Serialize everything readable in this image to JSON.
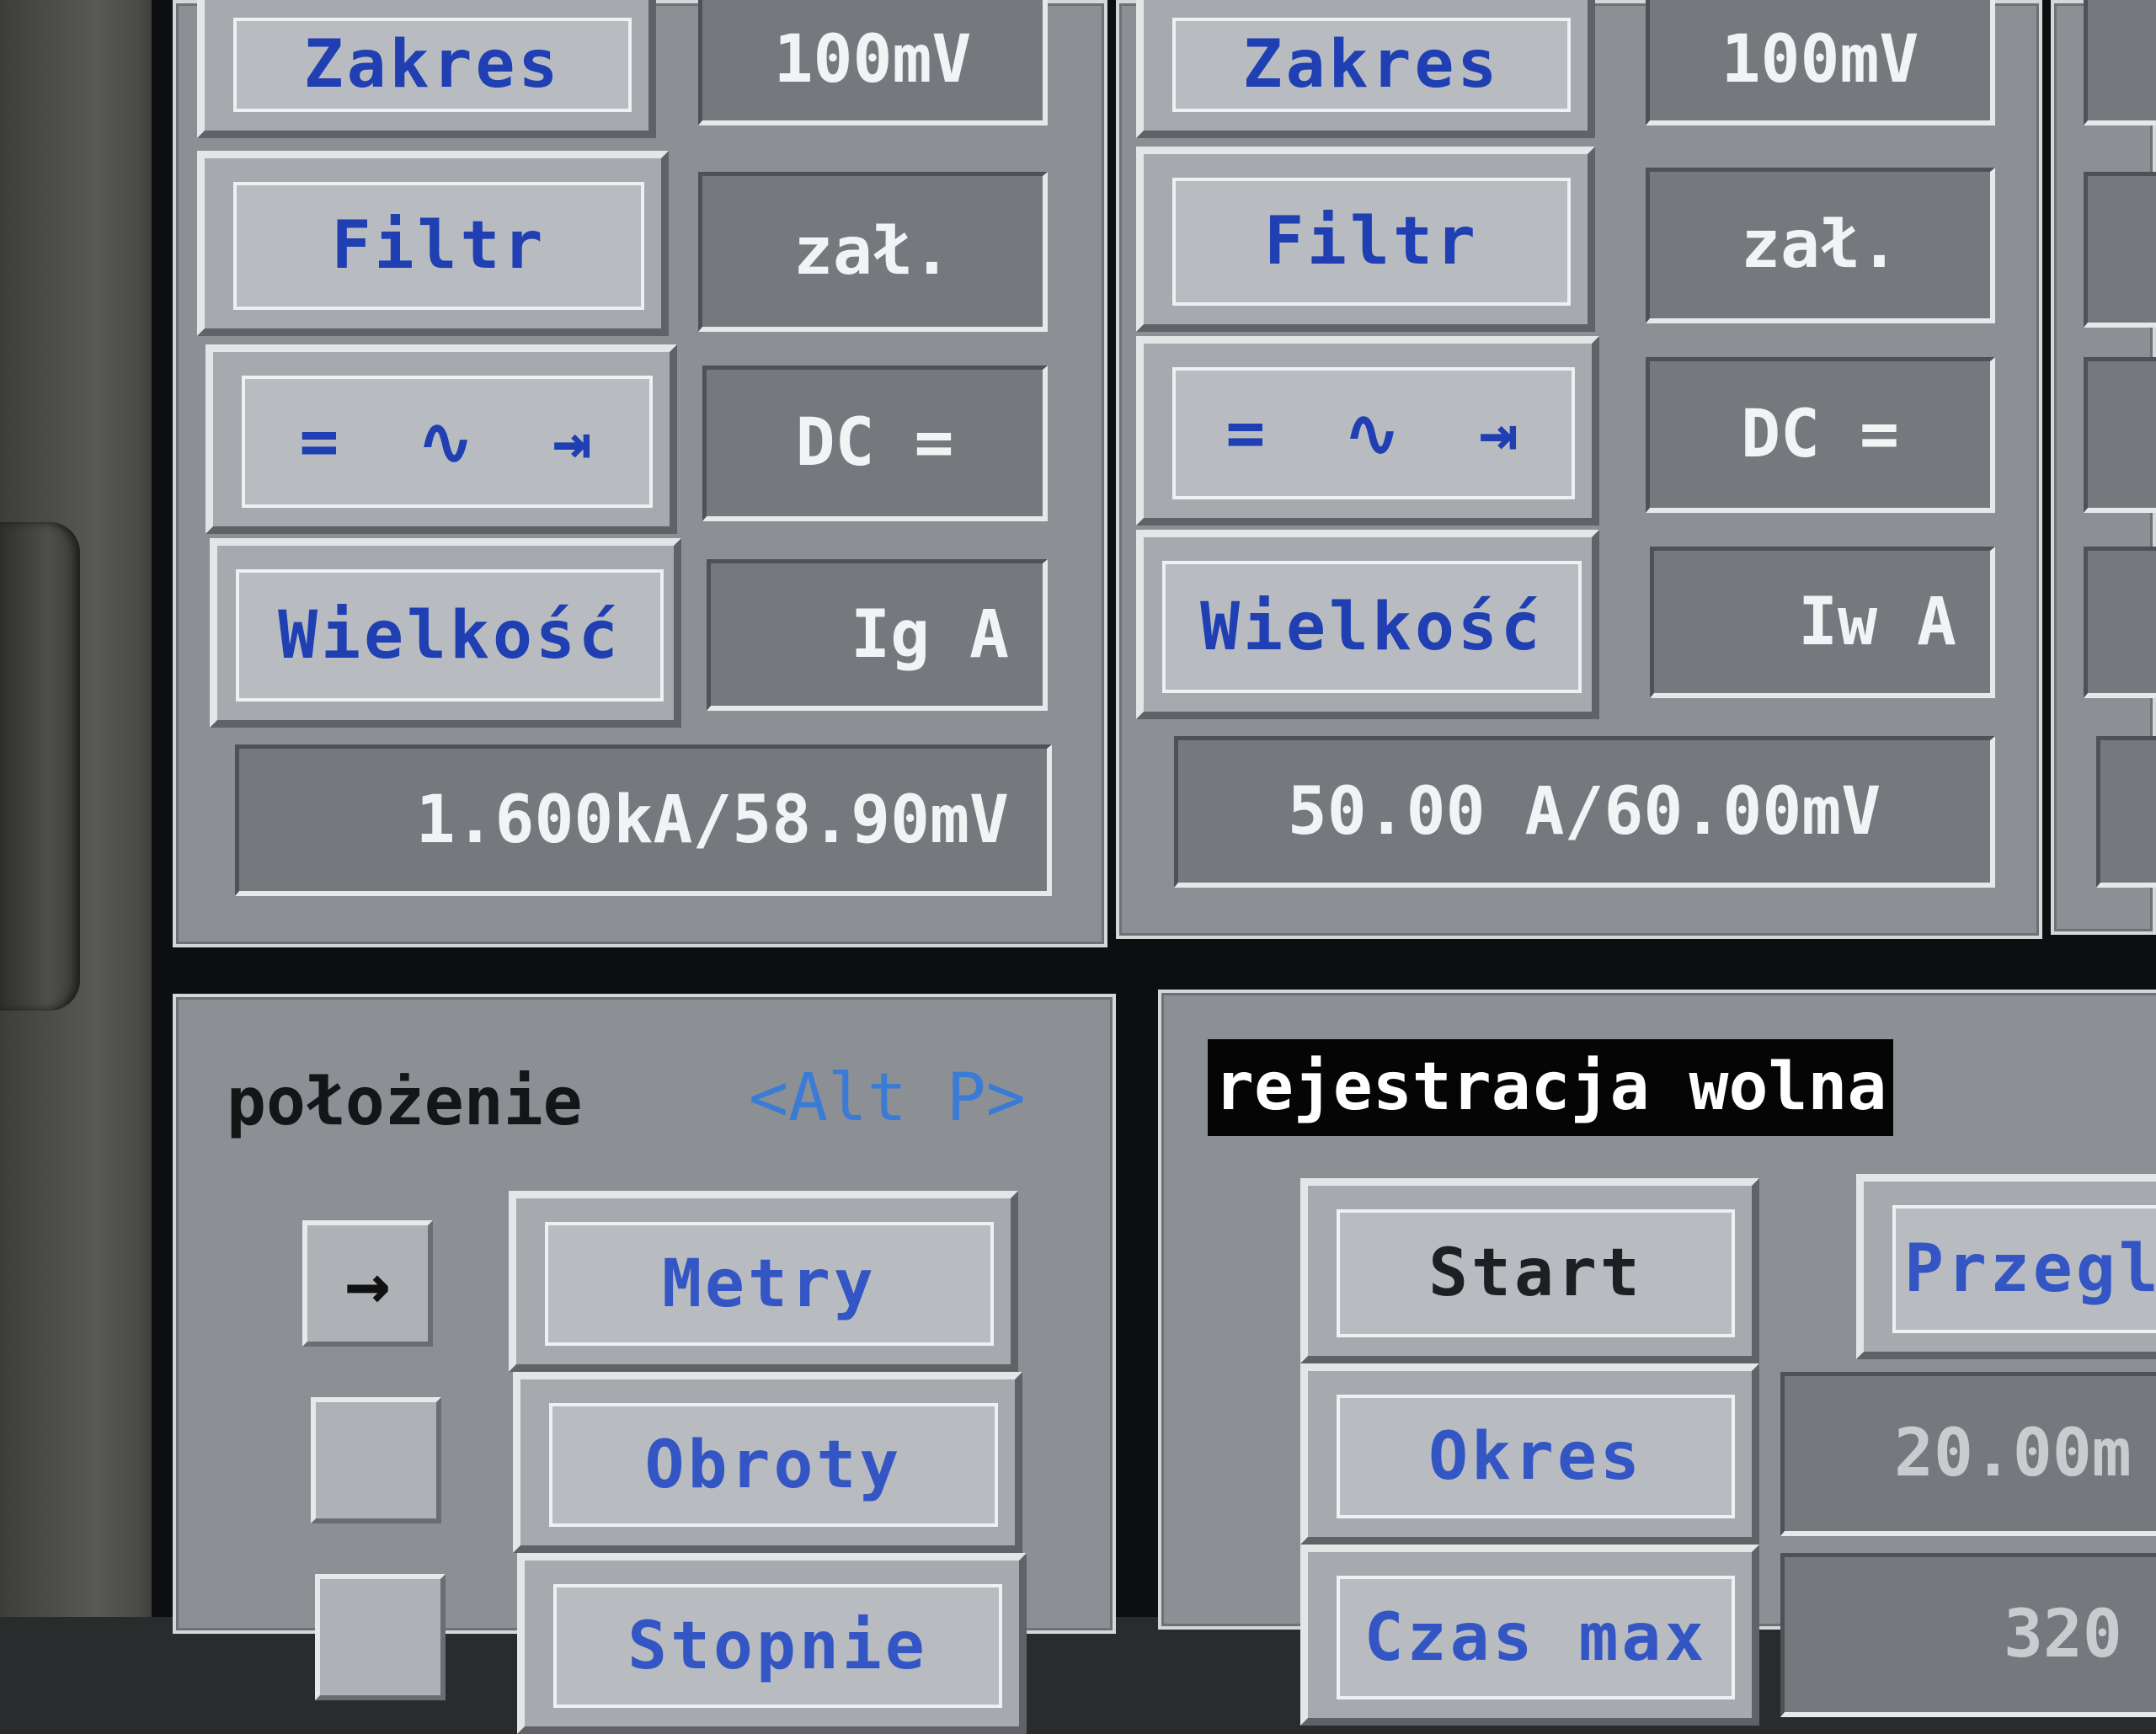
{
  "channel1": {
    "zakres_label": "Zakres",
    "zakres_value": "100mV",
    "filtr_label": "Filtr",
    "filtr_value": "zał.",
    "mode_symbols": [
      "=",
      "∿",
      "⇥"
    ],
    "mode_value": "DC =",
    "wielkosc_label": "Wielkość",
    "wielkosc_value": "Ig A",
    "ratio": "1.600kA/58.90mV"
  },
  "channel2": {
    "zakres_label": "Zakres",
    "zakres_value": "100mV",
    "filtr_label": "Filtr",
    "filtr_value": "zał.",
    "mode_symbols": [
      "=",
      "∿",
      "⇥"
    ],
    "mode_value": "DC =",
    "wielkosc_label": "Wielkość",
    "wielkosc_value": "Iw A",
    "ratio": "50.00 A/60.00mV"
  },
  "polozenie": {
    "title": "położenie",
    "shortcut": "<Alt P>",
    "arrow": "→",
    "options": [
      "Metry",
      "Obroty",
      "Stopnie"
    ]
  },
  "rejestracja": {
    "title": "rejestracja wolna",
    "start_label": "Start",
    "przeglad_label": "Przegl",
    "okres_label": "Okres",
    "okres_value": "20.00m",
    "czas_label": "Czas max",
    "czas_value": "320"
  },
  "colors": {
    "panel": "#8c9095",
    "button_text": "#1f3fb2",
    "value_text": "#f2f3f4",
    "shortcut": "#3a7bd5"
  }
}
